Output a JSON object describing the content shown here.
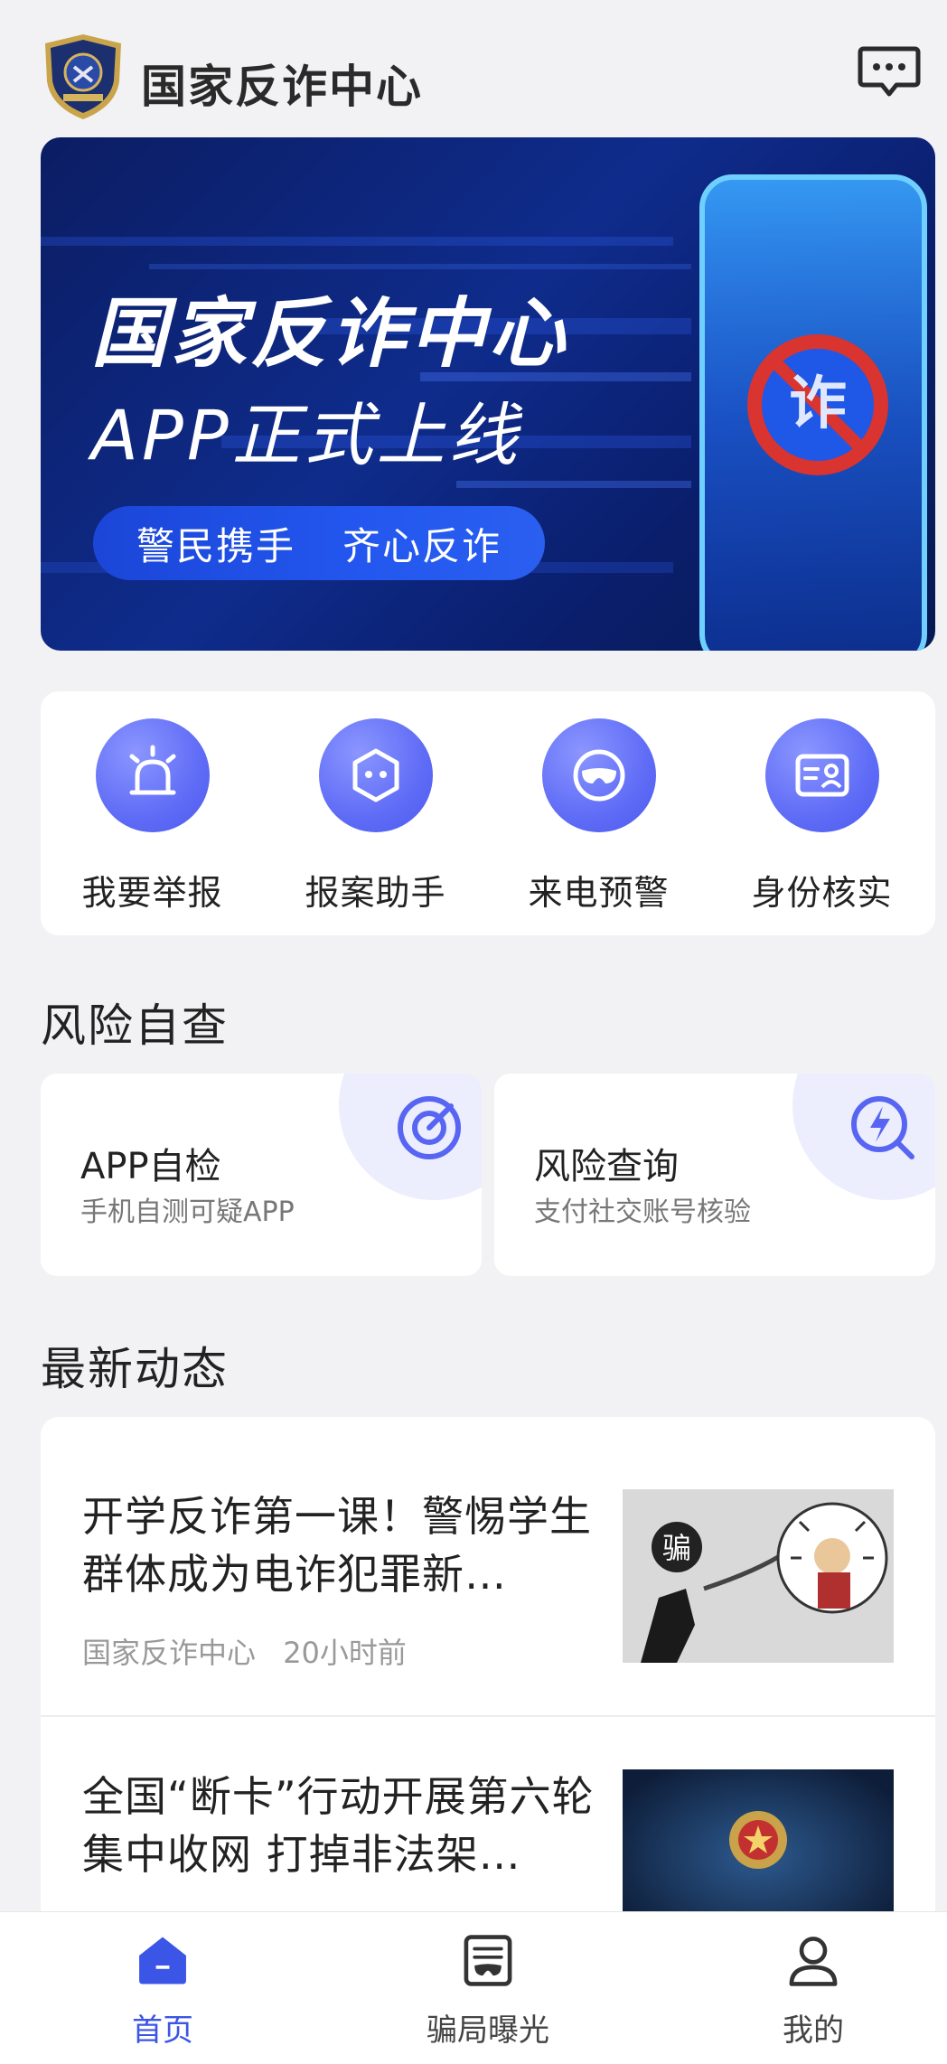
{
  "header": {
    "title": "国家反诈中心",
    "icons": {
      "logo": "police-badge-logo",
      "messages": "chat-bubble-icon"
    }
  },
  "banner": {
    "headline": "国家反诈中心",
    "subline": "APP正式上线",
    "slogan_left": "警民携手",
    "slogan_right": "齐心反诈",
    "badge_glyph": "诈"
  },
  "quick_actions": [
    {
      "label": "我要举报",
      "icon": "alarm-light-icon"
    },
    {
      "label": "报案助手",
      "icon": "robot-assistant-icon"
    },
    {
      "label": "来电预警",
      "icon": "mask-icon"
    },
    {
      "label": "身份核实",
      "icon": "id-card-icon"
    }
  ],
  "risk_section": {
    "title": "风险自查",
    "cards": [
      {
        "title": "APP自检",
        "subtitle": "手机自测可疑APP",
        "icon": "scan-target-icon"
      },
      {
        "title": "风险查询",
        "subtitle": "支付社交账号核验",
        "icon": "lightning-search-icon"
      }
    ]
  },
  "news_section": {
    "title": "最新动态",
    "items": [
      {
        "title": "开学反诈第一课！警惕学生群体成为电诈犯罪新…",
        "source": "国家反诈中心",
        "time": "20小时前",
        "thumb_text": "骗"
      },
      {
        "title": "全国“断卡”行动开展第六轮集中收网 打掉非法架…",
        "source": "",
        "time": ""
      }
    ]
  },
  "tabbar": {
    "tabs": [
      {
        "label": "首页",
        "icon": "home-icon",
        "active": true
      },
      {
        "label": "骗局曝光",
        "icon": "exposure-icon",
        "active": false
      },
      {
        "label": "我的",
        "icon": "profile-icon",
        "active": false
      }
    ]
  },
  "colors": {
    "accent": "#3b55e6",
    "icon_circle": "#5f6cf6",
    "banner_bg": "#0f2c8c",
    "page_bg": "#f2f2f4"
  }
}
